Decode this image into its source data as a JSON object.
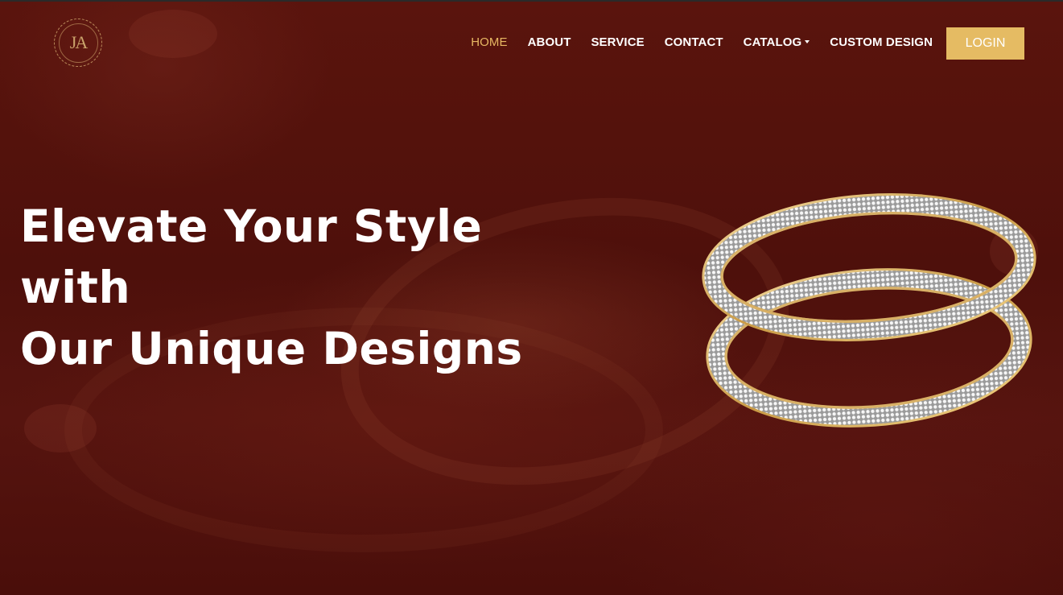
{
  "brand": {
    "logo_text": "JA"
  },
  "nav": {
    "items": [
      {
        "label": "HOME",
        "active": true
      },
      {
        "label": "ABOUT",
        "active": false
      },
      {
        "label": "SERVICE",
        "active": false
      },
      {
        "label": "CONTACT",
        "active": false
      },
      {
        "label": "CATALOG",
        "active": false,
        "dropdown": true
      },
      {
        "label": "CUSTOM DESIGN",
        "active": false
      }
    ],
    "login_label": "LOGIN"
  },
  "hero": {
    "headline_lines": [
      "Elevate Your Style",
      "with",
      "Our Unique Designs"
    ],
    "product_icon": "diamond-bangles-image"
  },
  "colors": {
    "accent": "#e5bb63",
    "active_link": "#e7b863",
    "background": "#4e100b",
    "text": "#ffffff"
  }
}
